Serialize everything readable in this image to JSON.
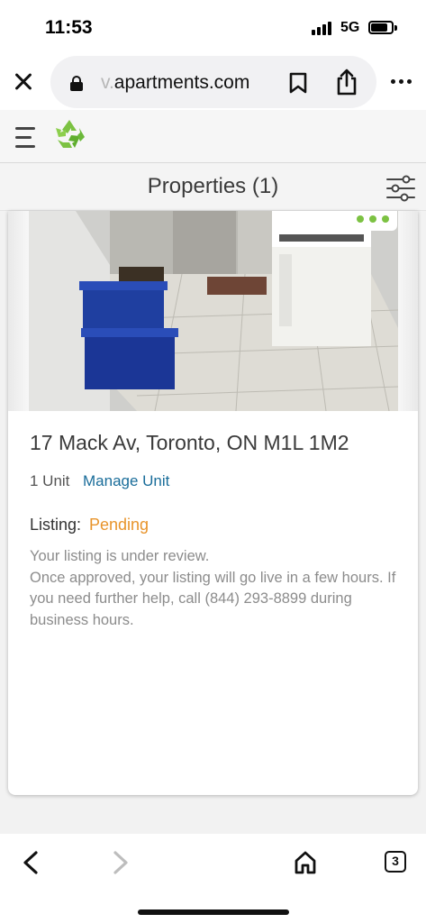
{
  "status_bar": {
    "time": "11:53",
    "network": "5G"
  },
  "browser": {
    "url_faded": "v.",
    "url_main": "apartments.com",
    "tab_count": "3",
    "icons": [
      "close-icon",
      "lock-icon",
      "bookmark-icon",
      "share-icon",
      "more-icon",
      "back-icon",
      "forward-icon",
      "home-icon",
      "tabs-icon"
    ]
  },
  "header": {
    "icons": [
      "hamburger-icon",
      "recycle-logo-icon"
    ],
    "accent_color": "#7cc242"
  },
  "properties_bar": {
    "title": "Properties (1)",
    "icons": [
      "filter-sliders-icon"
    ]
  },
  "property": {
    "address": "17 Mack Av, Toronto, ON M1L 1M2",
    "units": "1 Unit",
    "manage_label": "Manage Unit",
    "listing_label": "Listing:",
    "listing_status": "Pending",
    "status_color": "#e8942b",
    "link_color": "#1a6d9a",
    "review_line1": "Your listing is under review.",
    "review_line2": "Once approved, your listing will go live in a few hours. If you need further help, call (844) 293-8899 during business hours."
  }
}
